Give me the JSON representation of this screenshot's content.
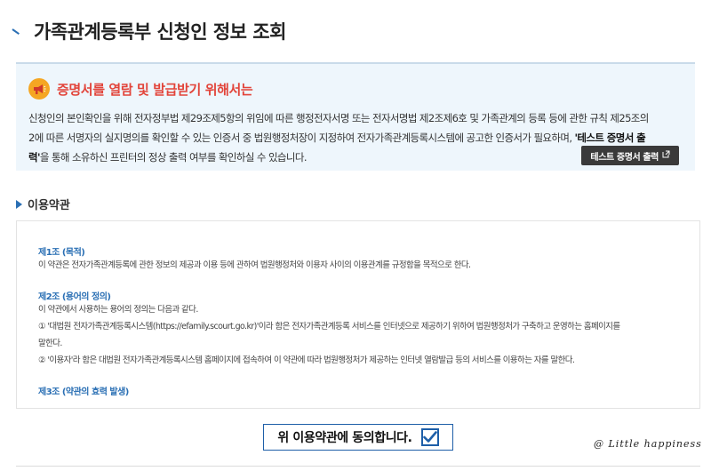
{
  "page": {
    "title": "가족관계등록부 신청인 정보 조회"
  },
  "notice": {
    "title": "증명서를 열람 및 발급받기 위해서는",
    "line1": "신청인의 본인확인을 위해 전자정부법 제29조제5항의 위임에 따른 행정전자서명 또는 전자서명법 제2조제6호 및 가족관계의 등록 등에 관한 규칙 제25조의",
    "line2_pre": "2에 따른 서명자의 실지명의를 확인할 수 있는 인증서 중 법원행정처장이 지정하여 전자가족관계등록시스템에 공고한 인증서가 필요하며, ",
    "line2_bold": "'테스트 증명서 출",
    "line3_bold": "력'",
    "line3_post": "을 통해 소유하신 프린터의 정상 출력 여부를 확인하실 수 있습니다.",
    "test_button": "테스트 증명서 출력"
  },
  "terms": {
    "section_label": "이용약관",
    "clause1_title": "제1조 (목적)",
    "clause1_text": "이 약관은 전자가족관계등록에 관한 정보의 제공과 이용 등에 관하여 법원행정처와 이용자 사이의 이용관계를 규정함을 목적으로 한다.",
    "clause2_title": "제2조 (용어의 정의)",
    "clause2_text1": "이 약관에서 사용하는 용어의 정의는 다음과 같다.",
    "clause2_text2": "① '대법원 전자가족관계등록시스템(https://efamily.scourt.go.kr)'이라 함은 전자가족관계등록 서비스를 인터넷으로 제공하기 위하여 법원행정처가 구축하고 운영하는 홈페이지를",
    "clause2_text3": "말한다.",
    "clause2_text4": "② '이용자'라 함은 대법원 전자가족관계등록시스템 홈페이지에 접속하여 이 약관에 따라 법원행정처가 제공하는 인터넷 열람발급 등의 서비스를 이용하는 자를 말한다.",
    "clause3_title": "제3조 (약관의 효력 발생)"
  },
  "agree": {
    "label": "위 이용약관에 동의합니다."
  },
  "watermark": "@ Little happiness",
  "icons": {
    "megaphone": "megaphone-icon",
    "checkbox": "checkmark-icon",
    "external": "external-link-icon"
  },
  "colors": {
    "accent": "#2a6fb4",
    "notice_title": "#e2443a",
    "notice_bg": "#eef6fc"
  }
}
